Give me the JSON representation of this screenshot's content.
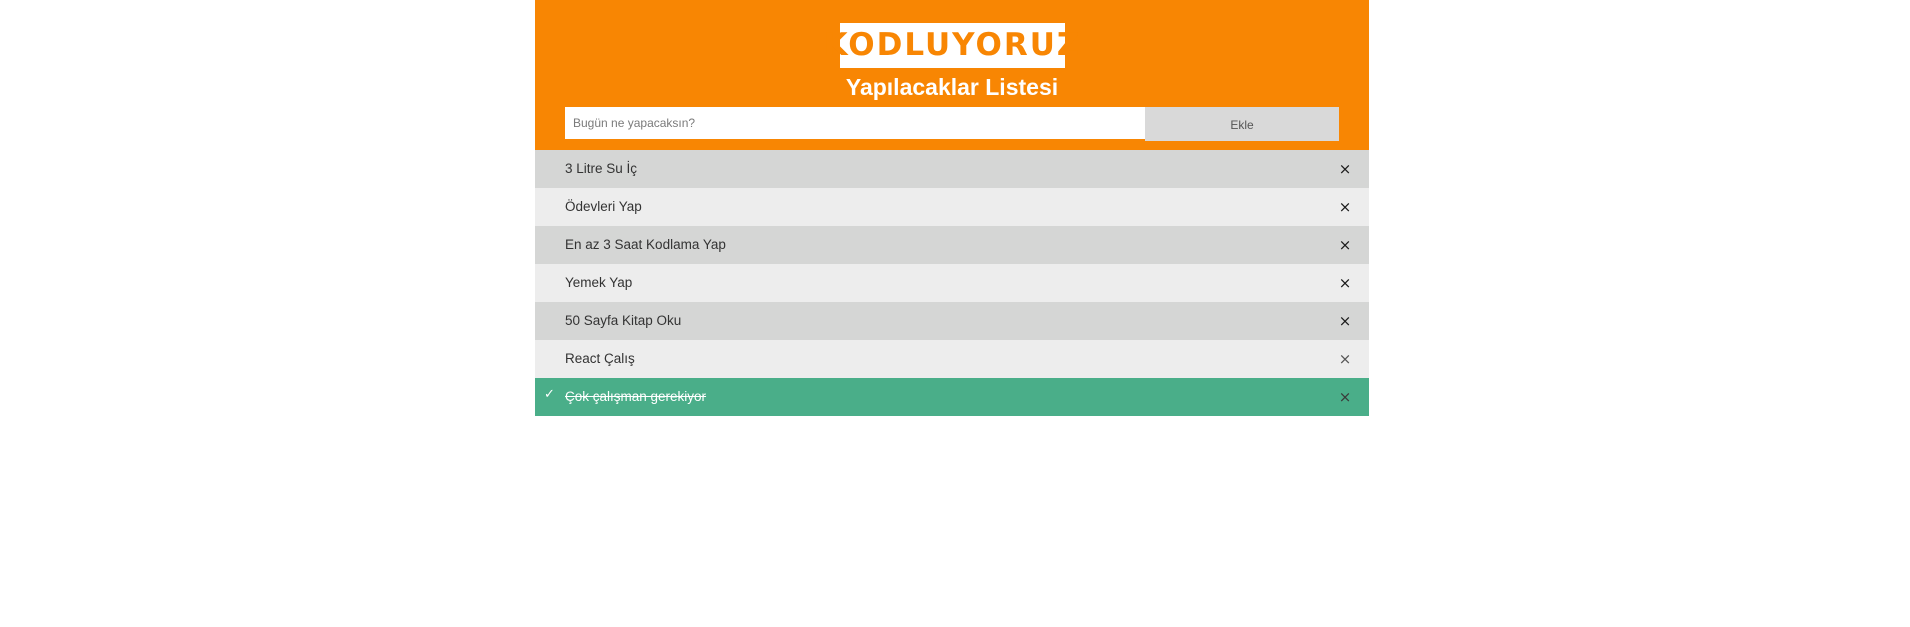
{
  "logo": {
    "text": "KODLUYORUZ",
    "color": "#f88603"
  },
  "header": {
    "title": "Yapılacaklar Listesi",
    "background": "#f88603"
  },
  "input": {
    "placeholder": "Bugün ne yapacaksın?",
    "value": ""
  },
  "add_button": {
    "label": "Ekle"
  },
  "todos": [
    {
      "text": "3 Litre Su İç",
      "checked": false
    },
    {
      "text": "Ödevleri Yap",
      "checked": false
    },
    {
      "text": "En az 3 Saat Kodlama Yap",
      "checked": false
    },
    {
      "text": "Yemek Yap",
      "checked": false
    },
    {
      "text": "50 Sayfa Kitap Oku",
      "checked": false
    },
    {
      "text": "React Çalış",
      "checked": false
    },
    {
      "text": "Çok çalışman gerekiyor",
      "checked": true
    }
  ],
  "icons": {
    "close": "close-icon",
    "check": "check-icon"
  },
  "colors": {
    "checked_bg": "#4aae89",
    "row_odd": "#d5d6d5",
    "row_even": "#ededed"
  }
}
